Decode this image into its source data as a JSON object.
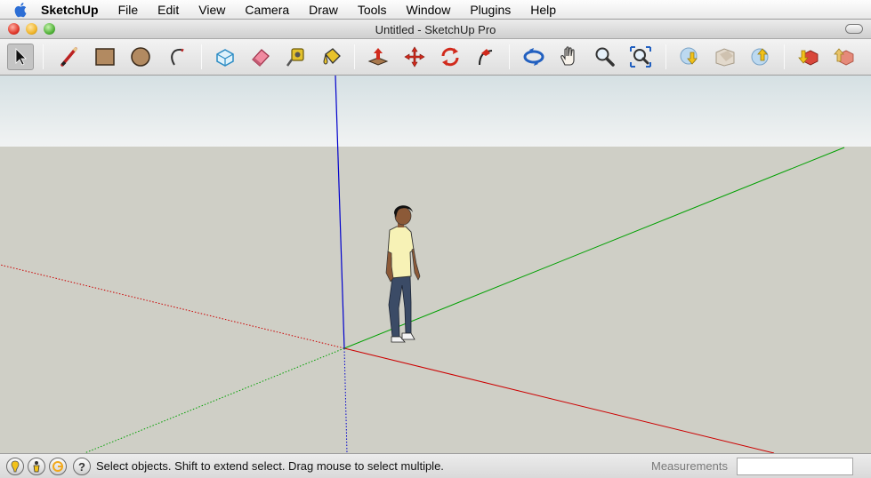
{
  "menubar": {
    "app_name": "SketchUp",
    "items": [
      "File",
      "Edit",
      "View",
      "Camera",
      "Draw",
      "Tools",
      "Window",
      "Plugins",
      "Help"
    ]
  },
  "window": {
    "title": "Untitled - SketchUp Pro"
  },
  "toolbar": {
    "tools": [
      {
        "name": "select",
        "icon": "arrow-cursor-icon",
        "selected": true
      },
      {
        "name": "line",
        "icon": "pencil-icon"
      },
      {
        "name": "rectangle",
        "icon": "rectangle-icon"
      },
      {
        "name": "circle",
        "icon": "circle-icon"
      },
      {
        "name": "arc",
        "icon": "arc-icon"
      },
      {
        "name": "make-component",
        "icon": "component-icon"
      },
      {
        "name": "eraser",
        "icon": "eraser-icon"
      },
      {
        "name": "tape-measure",
        "icon": "tape-measure-icon"
      },
      {
        "name": "paint-bucket",
        "icon": "paint-bucket-icon"
      },
      {
        "name": "push-pull",
        "icon": "push-pull-icon"
      },
      {
        "name": "move",
        "icon": "move-icon"
      },
      {
        "name": "rotate",
        "icon": "rotate-icon"
      },
      {
        "name": "follow-me",
        "icon": "follow-me-icon"
      },
      {
        "name": "orbit",
        "icon": "orbit-icon"
      },
      {
        "name": "pan",
        "icon": "hand-icon"
      },
      {
        "name": "zoom",
        "icon": "magnifier-icon"
      },
      {
        "name": "zoom-extents",
        "icon": "zoom-extents-icon"
      },
      {
        "name": "get-models",
        "icon": "get-models-icon"
      },
      {
        "name": "share-model",
        "icon": "share-model-icon"
      },
      {
        "name": "upload-model",
        "icon": "upload-icon"
      },
      {
        "name": "get-components",
        "icon": "get-components-icon"
      },
      {
        "name": "share-component",
        "icon": "share-component-icon"
      }
    ]
  },
  "statusbar": {
    "icons": [
      "geo-location-icon",
      "credits-icon",
      "sign-in-icon",
      "help-icon"
    ],
    "help_glyph": "?",
    "message": "Select objects. Shift to extend select. Drag mouse to select multiple.",
    "measurements_label": "Measurements",
    "measurements_value": ""
  },
  "colors": {
    "x_axis": "#cc0000",
    "y_axis": "#00a000",
    "z_axis": "#0000cc",
    "ground": "#cfcfc6",
    "sky_top": "#d5e0e3"
  }
}
